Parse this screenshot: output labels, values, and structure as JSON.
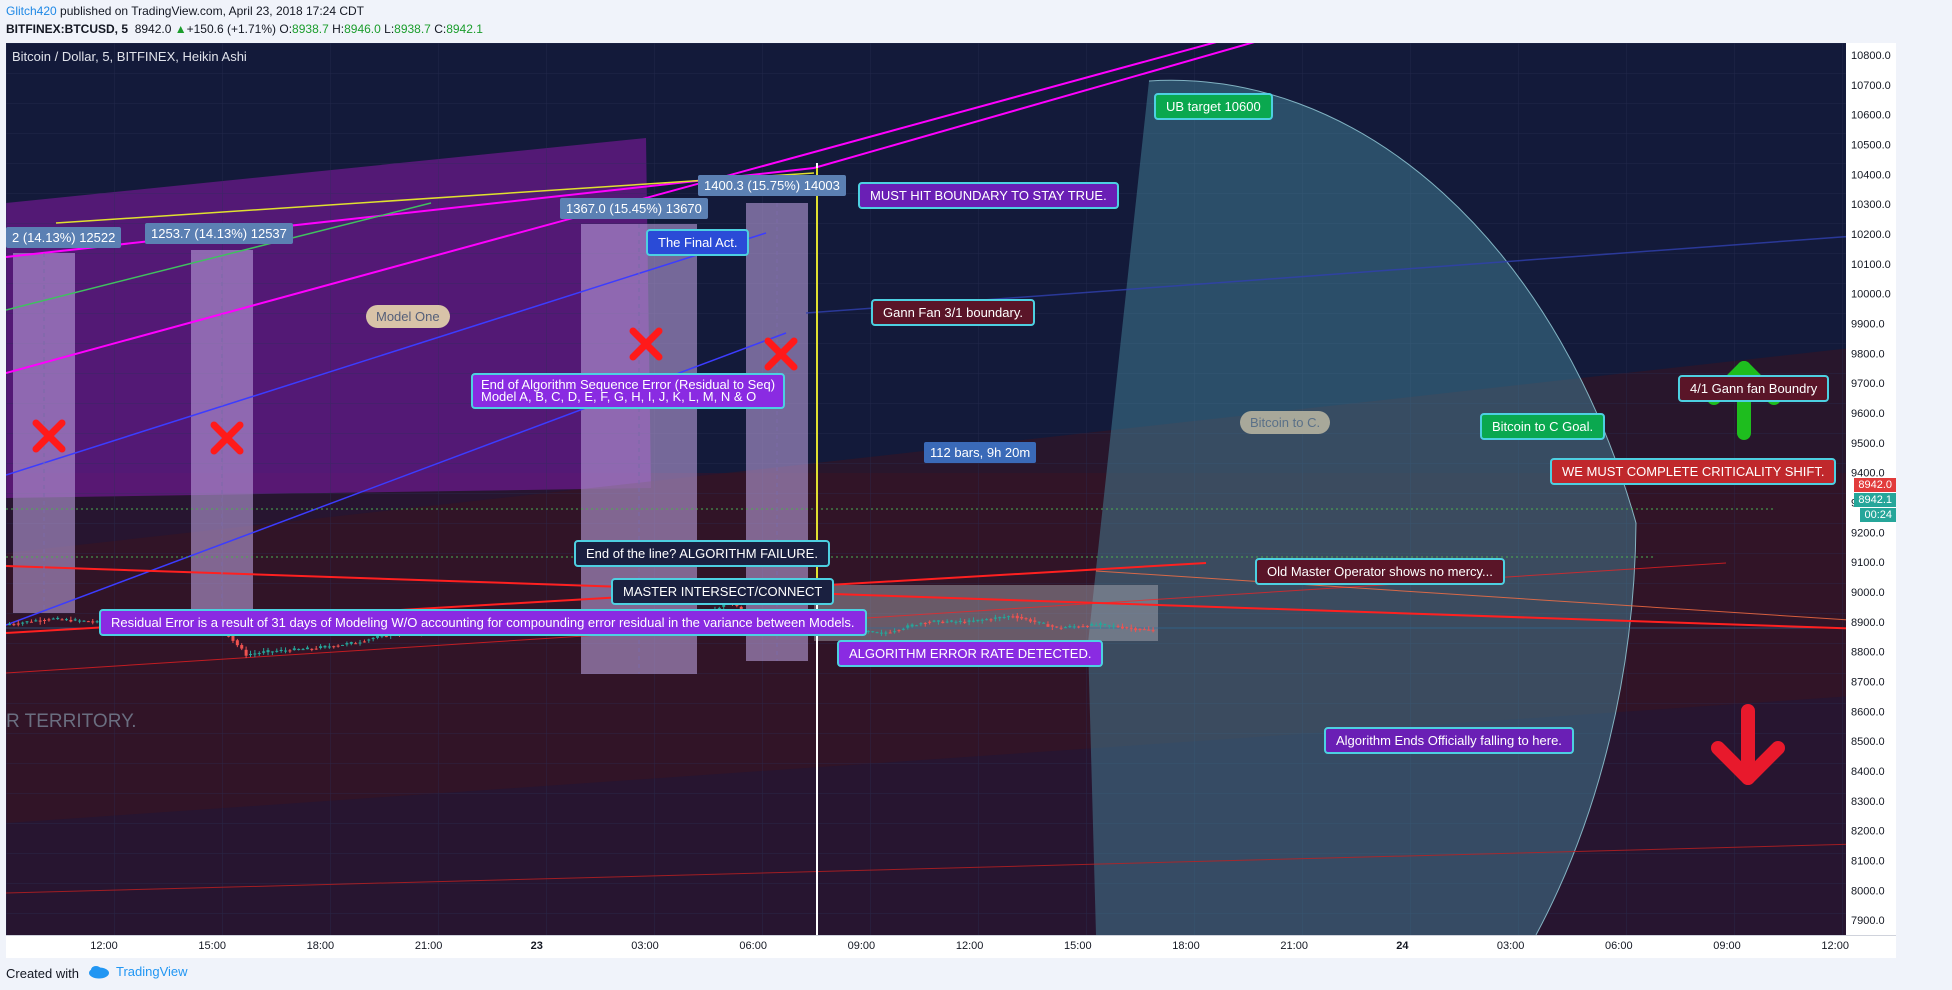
{
  "header": {
    "author": "Glitch420",
    "published": "published on TradingView.com, April 23, 2018 17:24 CDT",
    "symbol": "BITFINEX:BTCUSD, 5",
    "last": "8942.0",
    "change": "+150.6 (+1.71%)",
    "o_label": "O:",
    "o": "8938.7",
    "h_label": "H:",
    "h": "8946.0",
    "l_label": "L:",
    "l": "8938.7",
    "c_label": "C:",
    "c": "8942.1"
  },
  "chart_data": {
    "type": "candlestick",
    "title": "Bitcoin / Dollar, 5, BITFINEX, Heikin Ashi",
    "y_ticks": [
      7900,
      8000,
      8100,
      8200,
      8300,
      8400,
      8500,
      8600,
      8700,
      8800,
      8900,
      9000,
      9100,
      9200,
      9300,
      9400,
      9500,
      9600,
      9700,
      9800,
      9900,
      10000,
      10100,
      10200,
      10300,
      10400,
      10500,
      10600,
      10700,
      10800
    ],
    "x_ticks": [
      "12:00",
      "15:00",
      "18:00",
      "21:00",
      "23",
      "03:00",
      "06:00",
      "09:00",
      "12:00",
      "15:00",
      "18:00",
      "21:00",
      "24",
      "03:00",
      "06:00",
      "09:00",
      "12:00"
    ],
    "ylim": [
      7850,
      10840
    ],
    "price_path": [
      [
        0,
        8890
      ],
      [
        10,
        8910
      ],
      [
        20,
        8900
      ],
      [
        30,
        8870
      ],
      [
        40,
        8880
      ],
      [
        50,
        8870
      ],
      [
        55,
        8790
      ],
      [
        60,
        8800
      ],
      [
        70,
        8810
      ],
      [
        80,
        8830
      ],
      [
        85,
        8850
      ],
      [
        90,
        8860
      ],
      [
        100,
        8870
      ],
      [
        110,
        8890
      ],
      [
        120,
        8880
      ],
      [
        130,
        8860
      ],
      [
        140,
        8870
      ],
      [
        150,
        8900
      ],
      [
        160,
        8920
      ],
      [
        165,
        8970
      ],
      [
        170,
        8920
      ],
      [
        180,
        8900
      ],
      [
        190,
        8880
      ],
      [
        200,
        8860
      ],
      [
        210,
        8900
      ],
      [
        220,
        8900
      ],
      [
        230,
        8920
      ],
      [
        240,
        8880
      ],
      [
        250,
        8890
      ],
      [
        262,
        8870
      ]
    ],
    "current_price_labels": [
      "8942.0",
      "8942.1",
      "00:24"
    ]
  },
  "annotations": {
    "calc1": "2 (14.13%) 12522",
    "calc2": "1253.7 (14.13%) 12537",
    "calc3": "1367.0 (15.45%) 13670",
    "calc4": "1400.3 (15.75%) 14003",
    "ub_target": "UB target 10600",
    "must_hit": "MUST HIT BOUNDARY TO STAY TRUE.",
    "final_act": "The Final Act.",
    "gann31": "Gann Fan 3/1 boundary.",
    "model_one": "Model One",
    "end_algo_1": "End of Algorithm Sequence  Error (Residual to Seq)",
    "end_algo_2": "Model A, B, C, D, E, F, G, H, I, J, K, L, M, N & O",
    "bars_range": "112 bars, 9h 20m",
    "bitcoin_to_c": "Bitcoin to C.",
    "bitcoin_to_c_goal": "Bitcoin to C Goal.",
    "gann41": "4/1 Gann fan Boundry",
    "criticality": "WE MUST COMPLETE CRITICALITY SHIFT.",
    "end_line": "End of the line? ALGORITHM FAILURE.",
    "master_intersect": "MASTER INTERSECT/CONNECT",
    "residual_error": "Residual Error is a result of 31 days of Modeling W/O accounting for compounding error residual in the variance between Models.",
    "algo_error_rate": "ALGORITHM ERROR RATE DETECTED.",
    "old_master": "Old Master Operator shows no mercy...",
    "algo_ends": "Algorithm Ends Officially falling to here.",
    "territory": "R TERRITORY."
  },
  "footer": {
    "created_with": "Created with",
    "brand": "TradingView"
  },
  "colors": {
    "bg": "#131a3a",
    "magenta": "#ff00ff",
    "up_candle": "#26a69a",
    "down_candle": "#ef5350",
    "teal_arc": "#5fa7b8"
  }
}
